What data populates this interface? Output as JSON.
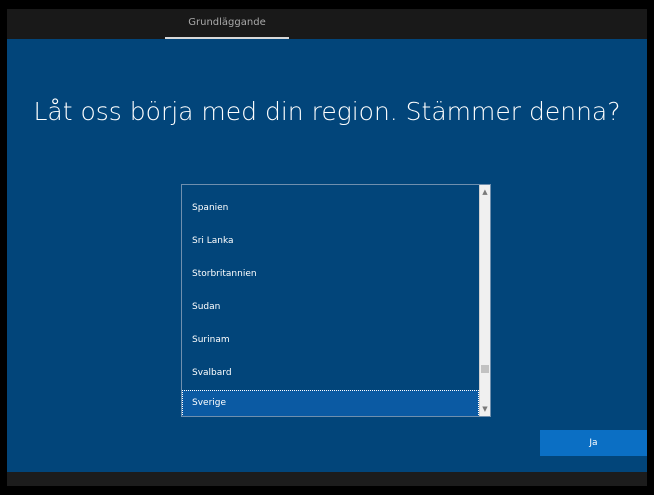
{
  "tabs": [
    {
      "label": "Grundläggande",
      "active": true
    }
  ],
  "title": "Låt oss börja med din region. Stämmer denna?",
  "region_list": {
    "items": [
      {
        "label": "Spanien",
        "selected": false
      },
      {
        "label": "Sri Lanka",
        "selected": false
      },
      {
        "label": "Storbritannien",
        "selected": false
      },
      {
        "label": "Sudan",
        "selected": false
      },
      {
        "label": "Surinam",
        "selected": false
      },
      {
        "label": "Svalbard",
        "selected": false
      },
      {
        "label": "Sverige",
        "selected": true
      }
    ],
    "scrollbar": {
      "up_icon": "chevron-up-icon",
      "down_icon": "chevron-down-icon"
    }
  },
  "yes_button_label": "Ja",
  "colors": {
    "background": "#02457a",
    "topbar": "#191919",
    "selected_item": "#0b5aa3",
    "accent_button": "#0b6fc4"
  }
}
